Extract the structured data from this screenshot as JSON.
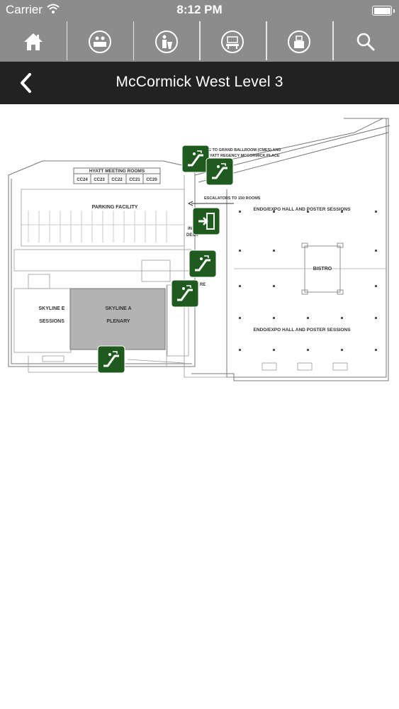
{
  "status_bar": {
    "carrier": "Carrier",
    "time": "8:12 PM"
  },
  "toolbar": {
    "items": [
      {
        "icon": "home-icon"
      },
      {
        "icon": "exhibitor-booth-icon"
      },
      {
        "icon": "speaker-podium-icon"
      },
      {
        "icon": "meeting-room-icon"
      },
      {
        "icon": "kiosk-icon"
      },
      {
        "icon": "search-icon"
      }
    ]
  },
  "header": {
    "title": "McCormick West Level 3"
  },
  "map": {
    "labels": {
      "hyatt_meeting_rooms": "HYATT MEETING ROOMS",
      "cc24": "CC24",
      "cc23": "CC23",
      "cc22": "CC22",
      "cc21": "CC21",
      "cc20": "CC20",
      "parking": "PARKING FACILITY",
      "bridge_1": "GE TO GRAND BALLROOM (CMES) AND",
      "bridge_2": "YATT REGENCY MCCORMICK PLACE",
      "escalators": "ESCALATORS TO 150 ROOMS",
      "endo_hall_top": "ENDO/EXPO HALL AND POSTER SESSIONS",
      "endo_hall_bottom": "ENDO/EXPO HALL AND POSTER SESSIONS",
      "bistro": "BISTRO",
      "skyline_e_1": "SKYLINE E",
      "skyline_e_2": "SESSIONS",
      "skyline_a_1": "SKYLINE A",
      "skyline_a_2": "PLENARY",
      "info_1": "IN",
      "info_2": "DESK",
      "other_1": "RE"
    },
    "marker_color": "#1f5a1f"
  }
}
